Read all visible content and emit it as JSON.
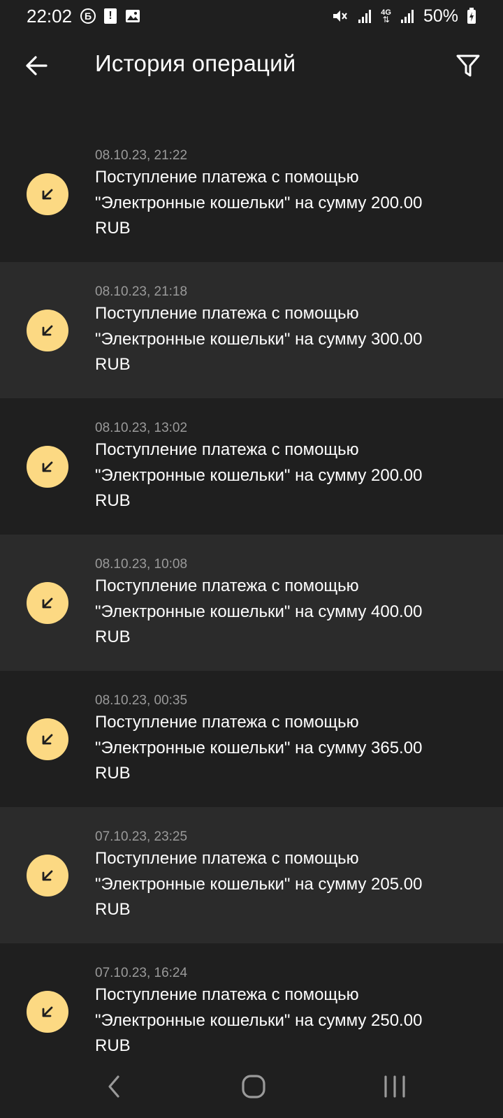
{
  "status_bar": {
    "time": "22:02",
    "battery": "50%",
    "network": "4G",
    "icons": [
      "b-circle-icon",
      "alert-icon",
      "image-icon",
      "mute-icon",
      "signal-icon",
      "signal-4g-icon",
      "battery-charging-icon"
    ]
  },
  "header": {
    "title": "История операций",
    "back_icon": "arrow-left-icon",
    "filter_icon": "filter-icon"
  },
  "operations": [
    {
      "date": "08.10.23, 21:22",
      "text": "Поступление платежа с помощью \"Электронные кошельки\" на сумму 200.00 RUB",
      "icon": "incoming-arrow-icon"
    },
    {
      "date": "08.10.23, 21:18",
      "text": "Поступление платежа с помощью \"Электронные кошельки\" на сумму 300.00 RUB",
      "icon": "incoming-arrow-icon"
    },
    {
      "date": "08.10.23, 13:02",
      "text": "Поступление платежа с помощью \"Электронные кошельки\" на сумму 200.00 RUB",
      "icon": "incoming-arrow-icon"
    },
    {
      "date": "08.10.23, 10:08",
      "text": "Поступление платежа с помощью \"Электронные кошельки\" на сумму 400.00 RUB",
      "icon": "incoming-arrow-icon"
    },
    {
      "date": "08.10.23, 00:35",
      "text": "Поступление платежа с помощью \"Электронные кошельки\" на сумму 365.00 RUB",
      "icon": "incoming-arrow-icon"
    },
    {
      "date": "07.10.23, 23:25",
      "text": "Поступление платежа с помощью \"Электронные кошельки\" на сумму 205.00 RUB",
      "icon": "incoming-arrow-icon"
    },
    {
      "date": "07.10.23, 16:24",
      "text": "Поступление платежа с помощью \"Электронные кошельки\" на сумму 250.00 RUB",
      "icon": "incoming-arrow-icon"
    }
  ],
  "colors": {
    "background": "#1f1f1f",
    "row_alt": "#2b2b2b",
    "accent_icon_bg": "#fcd983",
    "date_text": "#9a9a9a"
  },
  "nav_bar": {
    "icons": [
      "nav-back-icon",
      "nav-home-icon",
      "nav-recent-apps-icon"
    ]
  }
}
